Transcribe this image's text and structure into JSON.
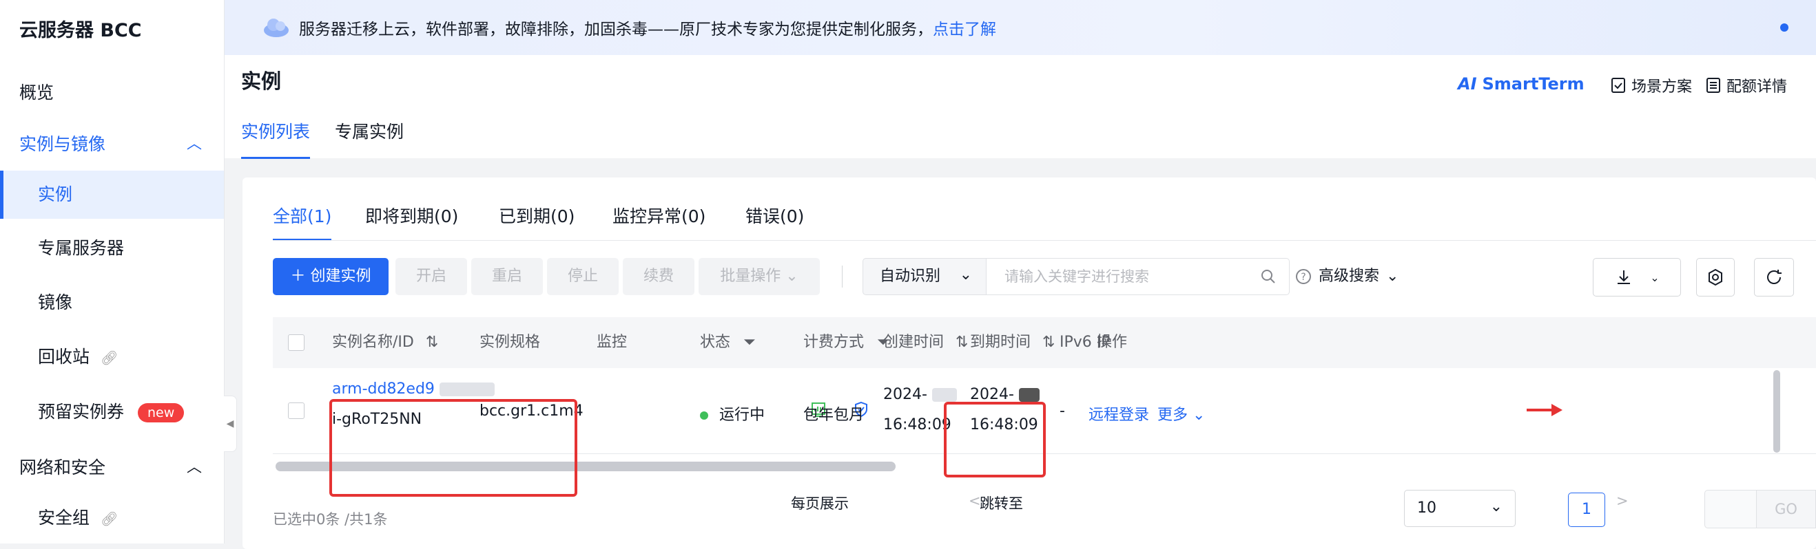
{
  "sidebar": {
    "title": "云服务器 BCC",
    "items": [
      {
        "label": "概览"
      },
      {
        "label": "实例与镜像"
      },
      {
        "label": "实例"
      },
      {
        "label": "专属服务器"
      },
      {
        "label": "镜像"
      },
      {
        "label": "回收站"
      },
      {
        "label": "预留实例券",
        "badge": "new"
      },
      {
        "label": "网络和安全"
      },
      {
        "label": "安全组"
      }
    ]
  },
  "banner": {
    "text": "服务器迁移上云，软件部署，故障排除，加固杀毒——原厂技术专家为您提供定制化服务，",
    "link": "点击了解"
  },
  "header": {
    "title": "实例",
    "tabs": [
      "实例列表",
      "专属实例"
    ],
    "actions": {
      "smartterm": "SmartTerm",
      "ai": "AI",
      "scenarios": "场景方案",
      "quota": "配额详情"
    }
  },
  "filter_tabs": [
    "全部(1)",
    "即将到期(0)",
    "已到期(0)",
    "监控异常(0)",
    "错误(0)"
  ],
  "toolbar": {
    "create": "创建实例",
    "start": "开启",
    "restart": "重启",
    "stop": "停止",
    "renew": "续费",
    "batch": "批量操作",
    "search_type": "自动识别",
    "search_placeholder": "请输入关键字进行搜索",
    "advanced": "高级搜索"
  },
  "table": {
    "columns": [
      "实例名称/ID",
      "实例规格",
      "监控",
      "状态",
      "计费方式",
      "创建时间",
      "到期时间",
      "IPv6 IP",
      "操作"
    ],
    "rows": [
      {
        "name": "arm-dd82ed9",
        "id": "i-gRoT25NN",
        "spec": "bcc.gr1.c1m4",
        "status": "运行中",
        "billing": "包年包月",
        "created_date": "2024-",
        "created_time": "16:48:09",
        "expire_date": "2024-",
        "expire_time": "16:48:09",
        "ipv6": "-",
        "op_login": "远程登录",
        "op_more": "更多"
      }
    ]
  },
  "footer": {
    "selected": "已选中0条 /共1条",
    "per_page_label": "每页展示",
    "per_page": "10",
    "page": "1",
    "jump_label": "跳转至",
    "go": "GO"
  },
  "colors": {
    "accent": "#2468f2",
    "annotation": "#e53333",
    "status_running": "#3fbf5a"
  }
}
